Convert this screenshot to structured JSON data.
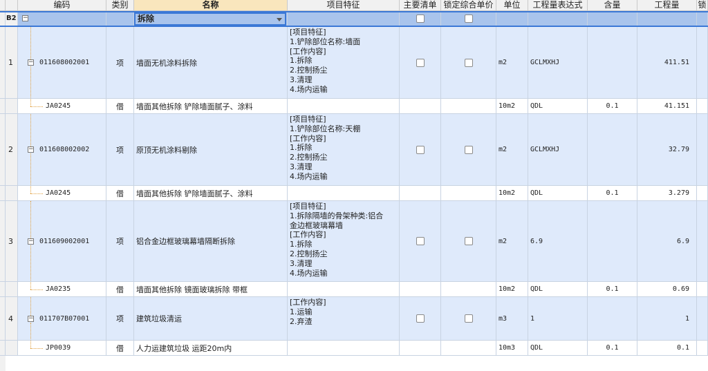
{
  "header": {
    "code": "编码",
    "type": "类别",
    "name": "名称",
    "feature": "项目特征",
    "main_list": "主要清单",
    "lock_price": "锁定综合单价",
    "unit": "单位",
    "qty_expr": "工程量表达式",
    "content": "含量",
    "qty": "工程量",
    "extra": "锁"
  },
  "section": {
    "row_id": "B2",
    "name": "拆除"
  },
  "rows": [
    {
      "no": "1",
      "code": "011608002001",
      "type": "项",
      "name": "墙面无机涂料拆除",
      "feature": "[项目特征]\n1.铲除部位名称:墙面\n[工作内容]\n1.拆除\n2.控制扬尘\n3.清理\n4.场内运输",
      "unit": "m2",
      "expr": "GCLMXHJ",
      "content": "",
      "qty": "411.51"
    },
    {
      "no": "",
      "code": "JA0245",
      "type": "借",
      "name": "墙面其他拆除 铲除墙面腻子、涂料",
      "feature": "",
      "unit": "10m2",
      "expr": "QDL",
      "content": "0.1",
      "qty": "41.151"
    },
    {
      "no": "2",
      "code": "011608002002",
      "type": "项",
      "name": "原顶无机涂料剔除",
      "feature": "[项目特征]\n1.铲除部位名称:天棚\n[工作内容]\n1.拆除\n2.控制扬尘\n3.清理\n4.场内运输",
      "unit": "m2",
      "expr": "GCLMXHJ",
      "content": "",
      "qty": "32.79"
    },
    {
      "no": "",
      "code": "JA0245",
      "type": "借",
      "name": "墙面其他拆除 铲除墙面腻子、涂料",
      "feature": "",
      "unit": "10m2",
      "expr": "QDL",
      "content": "0.1",
      "qty": "3.279"
    },
    {
      "no": "3",
      "code": "011609002001",
      "type": "项",
      "name": "铝合金边框玻璃幕墙隔断拆除",
      "feature": "[项目特征]\n1.拆除隔墙的骨架种类:铝合\n金边框玻璃幕墙\n[工作内容]\n1.拆除\n2.控制扬尘\n3.清理\n4.场内运输",
      "unit": "m2",
      "expr": "6.9",
      "content": "",
      "qty": "6.9"
    },
    {
      "no": "",
      "code": "JA0235",
      "type": "借",
      "name": "墙面其他拆除 镜面玻璃拆除 带框",
      "feature": "",
      "unit": "10m2",
      "expr": "QDL",
      "content": "0.1",
      "qty": "0.69"
    },
    {
      "no": "4",
      "code": "011707B07001",
      "type": "项",
      "name": "建筑垃圾清运",
      "feature": "[工作内容]\n1.运输\n2.弃渣",
      "unit": "m3",
      "expr": "1",
      "content": "",
      "qty": "1"
    },
    {
      "no": "",
      "code": "JP0039",
      "type": "借",
      "name": "人力运建筑垃圾 运距20m内",
      "feature": "",
      "unit": "10m3",
      "expr": "QDL",
      "content": "0.1",
      "qty": "0.1"
    }
  ]
}
